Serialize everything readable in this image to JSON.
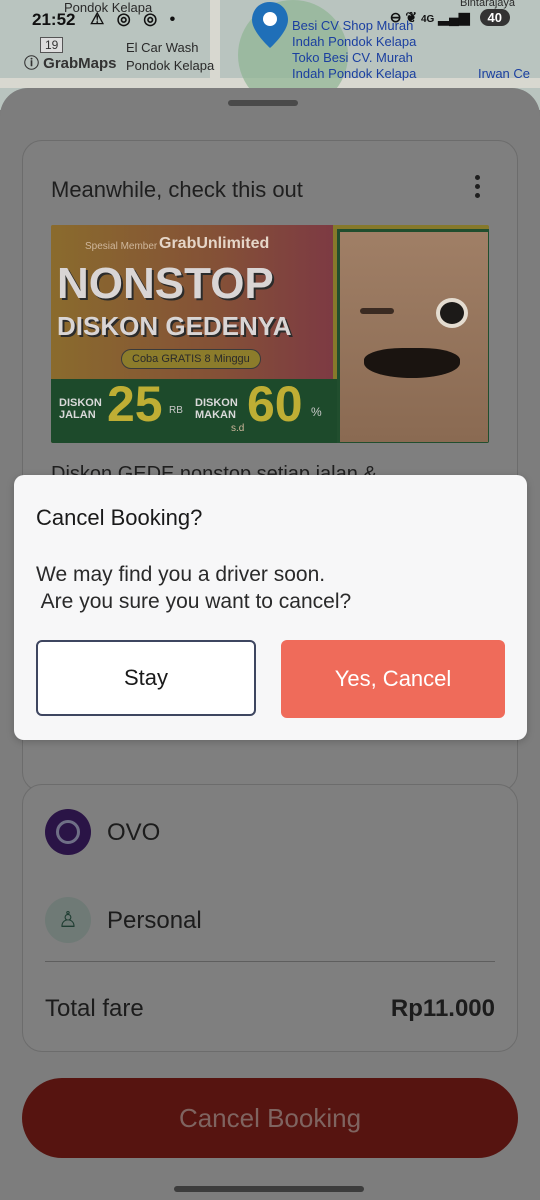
{
  "status_bar": {
    "time": "21:52",
    "left_icons": "⚠ ◎ ◎ •",
    "network": "4G",
    "battery": "40"
  },
  "map": {
    "brand": "GrabMaps",
    "route_number": "19",
    "labels": {
      "pondok_kelapa_top": "Pondok Kelapa",
      "el_car_wash": "El Car Wash",
      "pondok_kelapa": "Pondok Kelapa",
      "besi_cv_shop": "Besi CV Shop Murah",
      "indah_pondok_1": "Indah Pondok Kelapa",
      "toko_besi": "Toko Besi CV. Murah",
      "indah_pondok_2": "Indah Pondok Kelapa",
      "irwan": "Irwan Ce",
      "bintarajaya": "Bintarajaya"
    }
  },
  "promo": {
    "title": "Meanwhile, check this out",
    "banner": {
      "member_text": "Spesial Member",
      "brand": "GrabUnlimited",
      "headline_1": "NONSTOP",
      "headline_2": "DISKON GEDENYA",
      "pill": "Coba GRATIS 8 Minggu",
      "jalan_label": "DISKON JALAN",
      "jalan_value": "25",
      "jalan_unit": "RB",
      "makan_label": "DISKON MAKAN",
      "makan_value": "60",
      "makan_unit": "%",
      "sd": "s.d"
    },
    "text": "Diskon GEDE nonstop setiap jalan &"
  },
  "payment": {
    "method": "OVO",
    "profile": "Personal",
    "fare_label": "Total fare",
    "fare_value": "Rp11.000"
  },
  "cancel_button": "Cancel Booking",
  "dialog": {
    "title": "Cancel Booking?",
    "message": "We may find you a driver soon.\n Are you sure you want to cancel?",
    "stay_label": "Stay",
    "confirm_label": "Yes, Cancel"
  },
  "colors": {
    "confirm_button": "#ef6b5a",
    "cancel_booking_button": "#561410",
    "ovo_brand": "#4c2a86"
  }
}
